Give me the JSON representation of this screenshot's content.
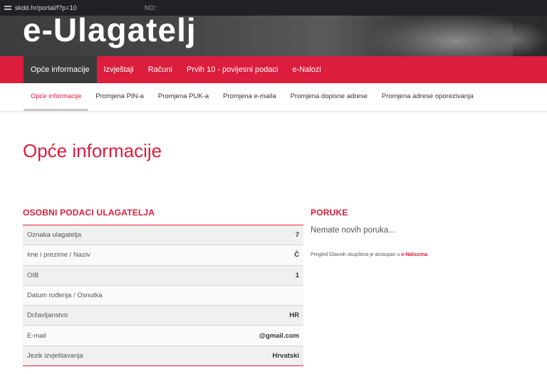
{
  "browser": {
    "url_prefix": "skdd.hr/portal/f?p=10",
    "url_suffix": "NO::"
  },
  "header": {
    "title": "e-Ulagatelj"
  },
  "main_nav": [
    {
      "label": "Opće informacije"
    },
    {
      "label": "Izvještaji"
    },
    {
      "label": "Računi"
    },
    {
      "label": "Prvih 10 - povijesni podaci"
    },
    {
      "label": "e-Nalozi"
    }
  ],
  "sub_nav": [
    {
      "label": "Opće informacije"
    },
    {
      "label": "Promjena PIN-a"
    },
    {
      "label": "Promjena PUK-a"
    },
    {
      "label": "Promjena e-maila"
    },
    {
      "label": "Promjena dopisne adrese"
    },
    {
      "label": "Promjena adrese oporezivanja"
    }
  ],
  "page": {
    "title": "Opće informacije"
  },
  "personal": {
    "title": "OSOBNI PODACI ULAGATELJA",
    "rows": [
      {
        "label": "Oznaka ulagatelja",
        "value": "7"
      },
      {
        "label": "Ime i prezime / Naziv",
        "value": "Č"
      },
      {
        "label": "OIB",
        "value": "1"
      },
      {
        "label": "Datum rođenja / Osnutka",
        "value": ""
      },
      {
        "label": "Državljanstvo",
        "value": "HR"
      },
      {
        "label": "E-mail",
        "value": "@gmail.com"
      },
      {
        "label": "Jezik izvještavanja",
        "value": "Hrvatski"
      }
    ]
  },
  "messages": {
    "title": "PORUKE",
    "empty_text": "Nemate novih poruka...",
    "note_text": "Pregled Glavnih skupština je dostupan u ",
    "note_link": "e-Nalozima",
    "note_end": "."
  }
}
